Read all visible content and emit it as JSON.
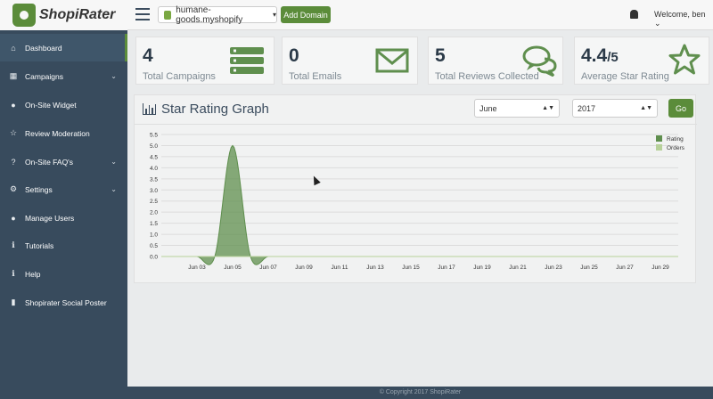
{
  "app": {
    "name": "ShopiRater"
  },
  "topbar": {
    "domain": "humane-goods.myshopify",
    "add_domain": "Add Domain",
    "welcome": "Welcome, ben ⌄"
  },
  "sidebar": {
    "items": [
      {
        "label": "Dashboard",
        "icon": "home-icon"
      },
      {
        "label": "Campaigns",
        "icon": "table-icon"
      },
      {
        "label": "On-Site Widget",
        "icon": "globe-icon"
      },
      {
        "label": "Review Moderation",
        "icon": "star-icon"
      },
      {
        "label": "On-Site FAQ's",
        "icon": "question-icon"
      },
      {
        "label": "Settings",
        "icon": "gears-icon"
      },
      {
        "label": "Manage Users",
        "icon": "users-icon"
      },
      {
        "label": "Tutorials",
        "icon": "info-icon"
      },
      {
        "label": "Help",
        "icon": "info-icon"
      },
      {
        "label": "Shopirater Social Poster",
        "icon": "file-icon"
      }
    ]
  },
  "stats": [
    {
      "value": "4",
      "label": "Total Campaigns",
      "icon": "server-icon"
    },
    {
      "value": "0",
      "label": "Total Emails",
      "icon": "envelope-icon"
    },
    {
      "value": "5",
      "label": "Total Reviews Collected",
      "icon": "comments-icon"
    },
    {
      "value": "4.4",
      "value_suffix": "/5",
      "label": "Average Star Rating",
      "icon": "star-outline-icon"
    }
  ],
  "graph": {
    "title": "Star Rating Graph",
    "month": "June",
    "year": "2017",
    "go": "Go"
  },
  "chart_data": {
    "type": "area",
    "xlabel": "",
    "ylabel": "",
    "ylim": [
      0,
      5.5
    ],
    "yticks": [
      "0.0",
      "0.5",
      "1.0",
      "1.5",
      "2.0",
      "2.5",
      "3.0",
      "3.5",
      "4.0",
      "4.5",
      "5.0",
      "5.5"
    ],
    "xticks": [
      "Jun 03",
      "Jun 05",
      "Jun 07",
      "Jun 09",
      "Jun 11",
      "Jun 13",
      "Jun 15",
      "Jun 17",
      "Jun 19",
      "Jun 21",
      "Jun 23",
      "Jun 25",
      "Jun 27",
      "Jun 29"
    ],
    "x": [
      "Jun 01",
      "Jun 02",
      "Jun 03",
      "Jun 04",
      "Jun 05",
      "Jun 06",
      "Jun 07",
      "Jun 08",
      "Jun 09",
      "Jun 10",
      "Jun 11",
      "Jun 12",
      "Jun 13",
      "Jun 14",
      "Jun 15",
      "Jun 16",
      "Jun 17",
      "Jun 18",
      "Jun 19",
      "Jun 20",
      "Jun 21",
      "Jun 22",
      "Jun 23",
      "Jun 24",
      "Jun 25",
      "Jun 26",
      "Jun 27",
      "Jun 28",
      "Jun 29",
      "Jun 30"
    ],
    "series": [
      {
        "name": "Rating",
        "color": "#5f8f4e",
        "values": [
          0,
          0,
          0,
          0,
          5,
          0,
          0,
          0,
          0,
          0,
          0,
          0,
          0,
          0,
          0,
          0,
          0,
          0,
          0,
          0,
          0,
          0,
          0,
          0,
          0,
          0,
          0,
          0,
          0,
          0
        ]
      },
      {
        "name": "Orders",
        "color": "#b7d19a",
        "values": [
          0,
          0,
          0,
          0,
          0,
          0,
          0,
          0,
          0,
          0,
          0,
          0,
          0,
          0,
          0,
          0,
          0,
          0,
          0,
          0,
          0,
          0,
          0,
          0,
          0,
          0,
          0,
          0,
          0,
          0
        ]
      }
    ],
    "legend": "top-right",
    "grid": true
  },
  "footer": {
    "text": "© Copyright 2017 ShopiRater"
  }
}
